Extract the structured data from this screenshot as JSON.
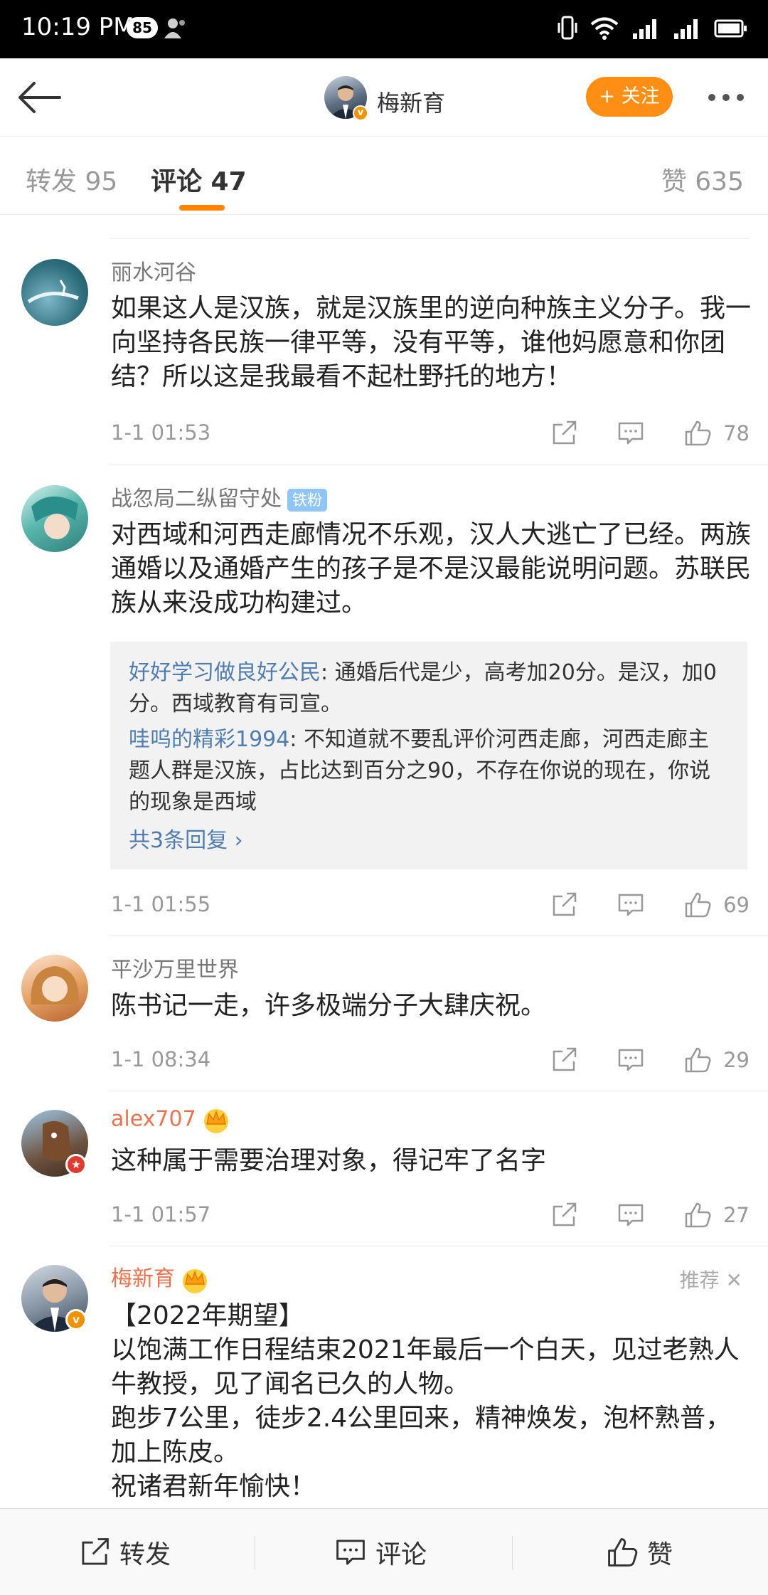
{
  "status_bar": {
    "time": "10:19 PM",
    "notification_count": "85"
  },
  "header": {
    "title": "梅新育",
    "follow_label": "+ 关注"
  },
  "tabs": [
    {
      "label": "转发 95"
    },
    {
      "label": "评论 47"
    },
    {
      "label": "赞 635"
    }
  ],
  "comments": [
    {
      "user": "丽水河谷",
      "text": "如果这人是汉族，就是汉族里的逆向种族主义分子。我一向坚持各民族一律平等，没有平等，谁他妈愿意和你团结？所以这是我最看不起杜野托的地方！",
      "time": "1-1 01:53",
      "likes": "78"
    },
    {
      "user": "战忽局二纵留守处",
      "fan_badge": "铁粉",
      "text": "对西域和河西走廊情况不乐观，汉人大逃亡了已经。两族通婚以及通婚产生的孩子是不是汉最能说明问题。苏联民族从来没成功构建过。",
      "replies": [
        {
          "user": "好好学习做良好公民",
          "text": ": 通婚后代是少，高考加20分。是汉，加0分。西域教育有司宣。"
        },
        {
          "user": "哇呜的精彩1994",
          "text": ": 不知道就不要乱评价河西走廊，河西走廊主题人群是汉族，占比达到百分之90，不存在你说的现在，你说的现象是西域"
        }
      ],
      "more_replies": "共3条回复",
      "time": "1-1 01:55",
      "likes": "69"
    },
    {
      "user": "平沙万里世界",
      "text": "陈书记一走，许多极端分子大肆庆祝。",
      "time": "1-1 08:34",
      "likes": "29"
    },
    {
      "user": "alex707",
      "text": "这种属于需要治理对象，得记牢了名字",
      "time": "1-1 01:57",
      "likes": "27"
    },
    {
      "user": "梅新育",
      "recommend": "推荐",
      "lines": [
        "【2022年期望】",
        "以饱满工作日程结束2021年最后一个白天，见过老熟人牛教授，见了闻名已久的人物。",
        "跑步7公里，徒步2.4公里回来，精神焕发，泡杯熟普，加上陈皮。",
        "祝诸君新年愉快！"
      ]
    }
  ],
  "bottom_bar": {
    "repost": "转发",
    "comment": "评论",
    "like": "赞"
  },
  "colors": {
    "accent": "#ff8200",
    "follow": "#fe8f14",
    "link": "#507daf",
    "vip_name": "#eb7350"
  }
}
